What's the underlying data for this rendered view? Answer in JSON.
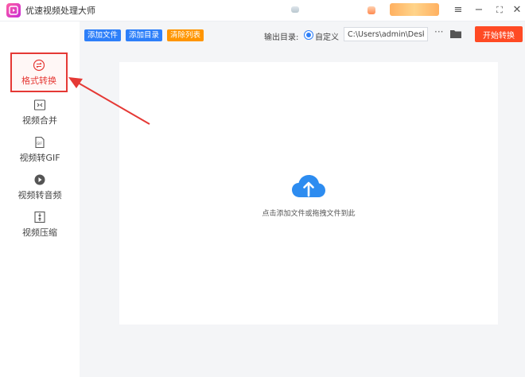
{
  "app": {
    "title": "优速视频处理大师"
  },
  "window_controls": {
    "menu": "≡",
    "minimize": "−",
    "maximize": "⛶",
    "close": "✕"
  },
  "sidebar": {
    "items": [
      {
        "label": "格式转换",
        "icon": "format-convert-icon",
        "active": true
      },
      {
        "label": "视频合并",
        "icon": "merge-icon"
      },
      {
        "label": "视频转GIF",
        "icon": "gif-icon"
      },
      {
        "label": "视频转音频",
        "icon": "audio-icon"
      },
      {
        "label": "视频压缩",
        "icon": "compress-icon"
      }
    ]
  },
  "toolbar": {
    "add_file": "添加文件",
    "add_folder": "添加目录",
    "clear_list": "清除列表",
    "output_label": "输出目录:",
    "custom_label": "自定义",
    "output_path": "C:\\Users\\admin\\Deskto",
    "more": "···",
    "start": "开始转换"
  },
  "dropzone": {
    "hint": "点击添加文件或拖拽文件到此",
    "icon": "cloud-upload-icon"
  },
  "colors": {
    "accent_blue": "#2d7ff9",
    "accent_orange": "#ff9500",
    "start_red": "#ff4a24",
    "highlight_red": "#e53935"
  }
}
